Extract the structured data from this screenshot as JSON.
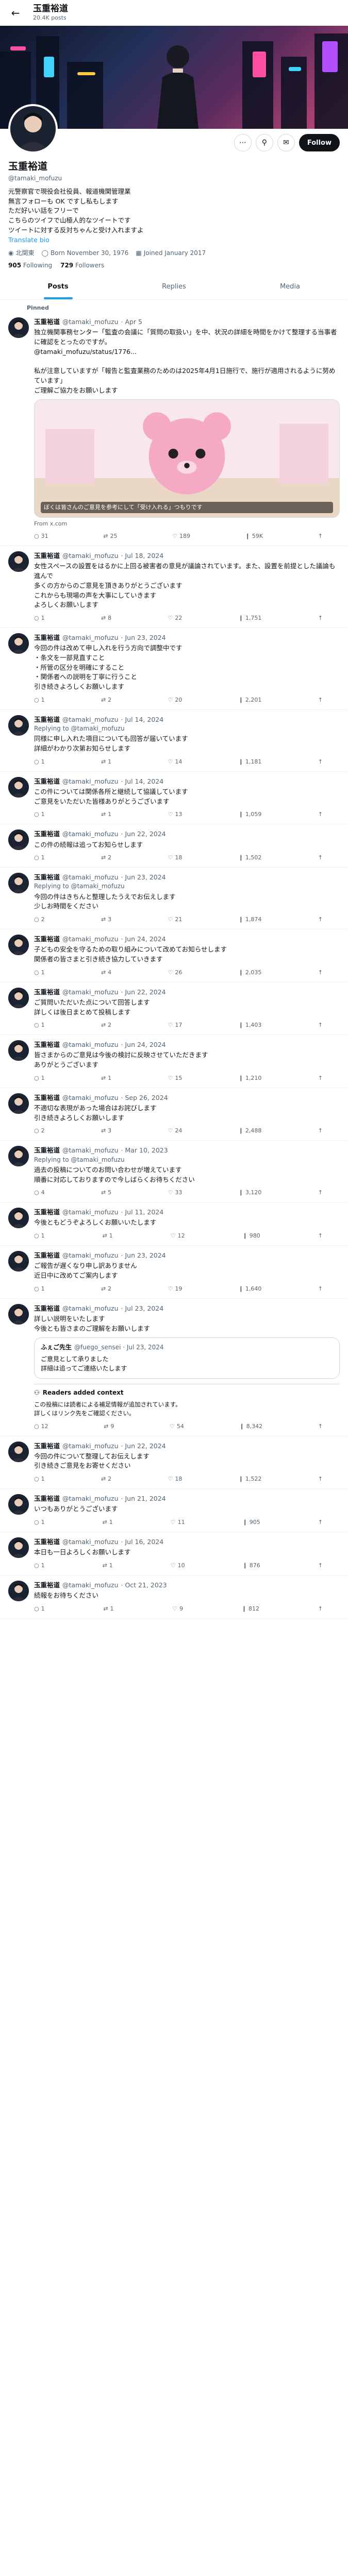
{
  "header": {
    "name": "玉重裕道",
    "post_count": "20.4K posts"
  },
  "profile": {
    "name": "玉重裕道",
    "handle": "@tamaki_mofuzu",
    "follow_label": "Follow",
    "bio": [
      "元警察官で現役会社役員、報道機関管理業",
      "無言フォローも OK ですし私もします",
      "ただ好いい話をフリーで",
      "こちらのツイフで山極人的なツイートです",
      "ツイートに対する反対ちゃんと受け入れますよ"
    ],
    "bio_link": "Translate bio",
    "location": "北関東",
    "born": "Born November 30, 1976",
    "joined": "Joined January 2017",
    "following": "905",
    "following_label": "Following",
    "followers": "729",
    "followers_label": "Followers"
  },
  "tabs": [
    {
      "label": "Posts"
    },
    {
      "label": "Replies"
    },
    {
      "label": "Media"
    }
  ],
  "pinned_label": "Pinned",
  "tweets": [
    {
      "name": "玉重裕道",
      "handle": "@tamaki_mofuzu",
      "date": "· Apr 5",
      "reply_to": "",
      "text": "独立機関事務センター「監査の会議に「質問の取扱い」を中、状況の詳細を時間をかけて整理する当事者に確認をとったのですが。\n@tamaki_mofuzu/status/1776...\n\n私が注意していますが「報告と監査業務のためのは2025年4月1日施行で、施行が適用されるように努めています」\nご理解ご協力をお願いします",
      "media": true,
      "media_caption": "ぼくは皆さんのご意見を参考にして「受け入れる」つもりです",
      "media_src": "From x.com",
      "replies": "31",
      "reposts": "25",
      "likes": "189",
      "views": "59K"
    },
    {
      "name": "玉重裕道",
      "handle": "@tamaki_mofuzu",
      "date": "· Jul 18, 2024",
      "reply_to": "",
      "text": "女性スペースの設置をはるかに上回る被害者の意見が議論されています。また、設置を前提とした議論も進んで\n多くの方からのご意見を頂きありがとうございます\nこれからも現場の声を大事にしていきます\nよろしくお願いします",
      "media": false,
      "replies": "1",
      "reposts": "8",
      "likes": "22",
      "views": "1,751"
    },
    {
      "name": "玉重裕道",
      "handle": "@tamaki_mofuzu",
      "date": "· Jun 23, 2024",
      "reply_to": "",
      "text": "今回の件は改めて申し入れを行う方向で調整中です\n・条文を一部見直すこと\n・所管の区分を明確にすること\n・関係者への説明を丁寧に行うこと\n引き続きよろしくお願いします",
      "media": false,
      "replies": "1",
      "reposts": "2",
      "likes": "20",
      "views": "2,201"
    },
    {
      "name": "玉重裕道",
      "handle": "@tamaki_mofuzu",
      "date": "· Jul 14, 2024",
      "reply_to": "Replying to @tamaki_mofuzu",
      "text": "同様に申し入れた項目についても回答が届いています\n詳細がわかり次第お知らせします",
      "media": false,
      "replies": "1",
      "reposts": "1",
      "likes": "14",
      "views": "1,181"
    },
    {
      "name": "玉重裕道",
      "handle": "@tamaki_mofuzu",
      "date": "· Jul 14, 2024",
      "reply_to": "",
      "text": "この件については関係各所と継続して協議しています\nご意見をいただいた皆様ありがとうございます",
      "media": false,
      "replies": "1",
      "reposts": "1",
      "likes": "13",
      "views": "1,059"
    },
    {
      "name": "玉重裕道",
      "handle": "@tamaki_mofuzu",
      "date": "· Jun 22, 2024",
      "reply_to": "",
      "text": "この件の続報は追ってお知らせします",
      "media": false,
      "replies": "1",
      "reposts": "2",
      "likes": "18",
      "views": "1,502"
    },
    {
      "name": "玉重裕道",
      "handle": "@tamaki_mofuzu",
      "date": "· Jun 23, 2024",
      "reply_to": "Replying to @tamaki_mofuzu",
      "text": "今回の件はきちんと整理したうえでお伝えします\n少しお時間をください",
      "media": false,
      "replies": "2",
      "reposts": "3",
      "likes": "21",
      "views": "1,874"
    },
    {
      "name": "玉重裕道",
      "handle": "@tamaki_mofuzu",
      "date": "· Jun 24, 2024",
      "reply_to": "",
      "text": "子どもの安全を守るための取り組みについて改めてお知らせします\n関係者の皆さまと引き続き協力していきます",
      "media": false,
      "replies": "1",
      "reposts": "4",
      "likes": "26",
      "views": "2,035"
    },
    {
      "name": "玉重裕道",
      "handle": "@tamaki_mofuzu",
      "date": "· Jun 22, 2024",
      "reply_to": "",
      "text": "ご質問いただいた点について回答します\n詳しくは後日まとめて投稿します",
      "media": false,
      "replies": "1",
      "reposts": "2",
      "likes": "17",
      "views": "1,403"
    },
    {
      "name": "玉重裕道",
      "handle": "@tamaki_mofuzu",
      "date": "· Jun 24, 2024",
      "reply_to": "",
      "text": "皆さまからのご意見は今後の検討に反映させていただきます\nありがとうございます",
      "media": false,
      "replies": "1",
      "reposts": "1",
      "likes": "15",
      "views": "1,210"
    },
    {
      "name": "玉重裕道",
      "handle": "@tamaki_mofuzu",
      "date": "· Sep 26, 2024",
      "reply_to": "",
      "text": "不適切な表現があった場合はお詫びします\n引き続きよろしくお願いします",
      "media": false,
      "replies": "2",
      "reposts": "3",
      "likes": "24",
      "views": "2,488"
    },
    {
      "name": "玉重裕道",
      "handle": "@tamaki_mofuzu",
      "date": "· Mar 10, 2023",
      "reply_to": "Replying to @tamaki_mofuzu",
      "text": "過去の投稿についてのお問い合わせが増えています\n順番に対応しておりますので今しばらくお待ちください",
      "media": false,
      "replies": "4",
      "reposts": "5",
      "likes": "33",
      "views": "3,120"
    },
    {
      "name": "玉重裕道",
      "handle": "@tamaki_mofuzu",
      "date": "· Jul 11, 2024",
      "reply_to": "",
      "text": "今後ともどうぞよろしくお願いいたします",
      "media": false,
      "replies": "1",
      "reposts": "1",
      "likes": "12",
      "views": "980"
    },
    {
      "name": "玉重裕道",
      "handle": "@tamaki_mofuzu",
      "date": "· Jun 23, 2024",
      "reply_to": "",
      "text": "ご報告が遅くなり申し訳ありません\n近日中に改めてご案内します",
      "media": false,
      "replies": "1",
      "reposts": "2",
      "likes": "19",
      "views": "1,640"
    },
    {
      "name": "玉重裕道",
      "handle": "@tamaki_mofuzu",
      "date": "· Jul 23, 2024",
      "reply_to": "",
      "text": "詳しい説明をいたします\n今後とも皆さまのご理解をお願いします",
      "media": false,
      "quote": {
        "name": "ふぇご先生",
        "handle": "@fuego_sensei · Jul 23, 2024",
        "text": "ご意見として承りました\n詳細は追ってご連絡いたします"
      },
      "note_title": "Readers added context",
      "note_text": "この投稿には読者による補足情報が追加されています。\n詳しくはリンク先をご確認ください。",
      "replies": "12",
      "reposts": "9",
      "likes": "54",
      "views": "8,342"
    },
    {
      "name": "玉重裕道",
      "handle": "@tamaki_mofuzu",
      "date": "· Jun 22, 2024",
      "reply_to": "",
      "text": "今回の件について整理してお伝えします\n引き続きご意見をお寄せください",
      "media": false,
      "replies": "1",
      "reposts": "2",
      "likes": "18",
      "views": "1,522"
    },
    {
      "name": "玉重裕道",
      "handle": "@tamaki_mofuzu",
      "date": "· Jun 21, 2024",
      "reply_to": "",
      "text": "いつもありがとうございます",
      "media": false,
      "replies": "1",
      "reposts": "1",
      "likes": "11",
      "views": "905"
    },
    {
      "name": "玉重裕道",
      "handle": "@tamaki_mofuzu",
      "date": "· Jul 16, 2024",
      "reply_to": "",
      "text": "本日も一日よろしくお願いします",
      "media": false,
      "replies": "1",
      "reposts": "1",
      "likes": "10",
      "views": "876"
    },
    {
      "name": "玉重裕道",
      "handle": "@tamaki_mofuzu",
      "date": "· Oct 21, 2023",
      "reply_to": "",
      "text": "続報をお待ちください",
      "media": false,
      "replies": "1",
      "reposts": "1",
      "likes": "9",
      "views": "812"
    }
  ]
}
